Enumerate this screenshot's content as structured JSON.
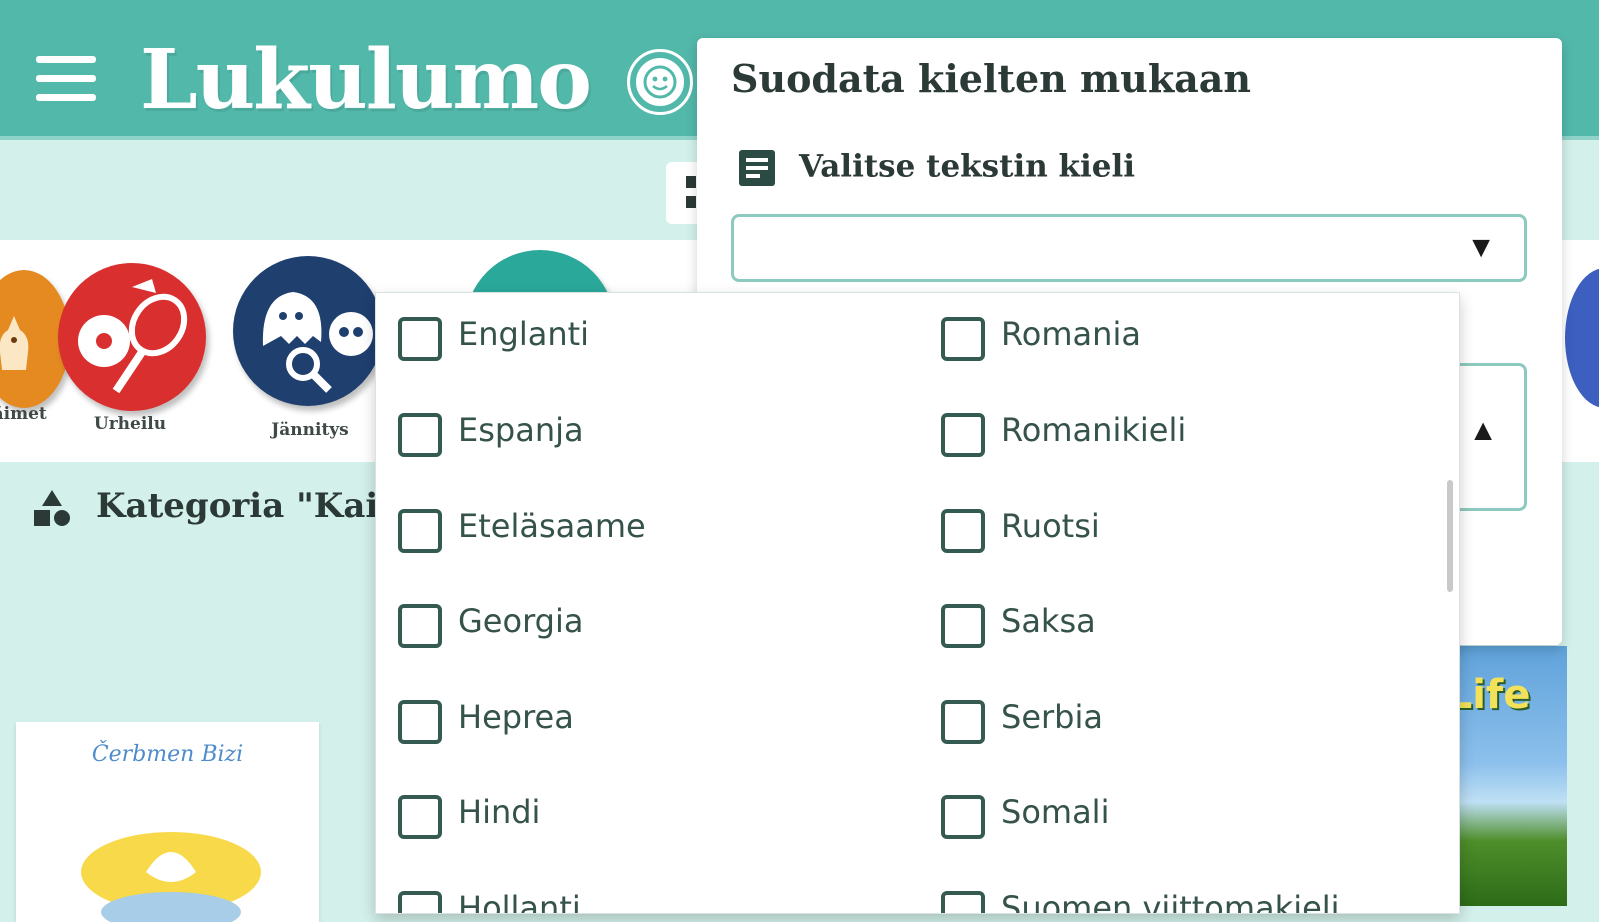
{
  "header": {
    "logo": "Lukulumo"
  },
  "categories": [
    {
      "label": "Eläimet"
    },
    {
      "label": "Urheilu"
    },
    {
      "label": "Jännitys"
    }
  ],
  "category_heading": "Kategoria \"Kai",
  "books": [
    {
      "title": "Čerbmen Bizi"
    },
    {
      "title": "s Life"
    }
  ],
  "filter_panel": {
    "title": "Suodata kielten mukaan",
    "text_language_label": "Valitse tekstin kieli",
    "text_language_value": "",
    "select_arrow_down": "▼",
    "select_arrow_up": "▲"
  },
  "language_options": {
    "left": [
      "Englanti",
      "Espanja",
      "Eteläsaame",
      "Georgia",
      "Heprea",
      "Hindi",
      "Hollanti"
    ],
    "right": [
      "Romania",
      "Romanikieli",
      "Ruotsi",
      "Saksa",
      "Serbia",
      "Somali",
      "Suomen viittomakieli"
    ]
  },
  "colors": {
    "brand_teal": "#52b8aa",
    "background_mint": "#d3f0ea",
    "checkbox_border": "#355a52"
  }
}
